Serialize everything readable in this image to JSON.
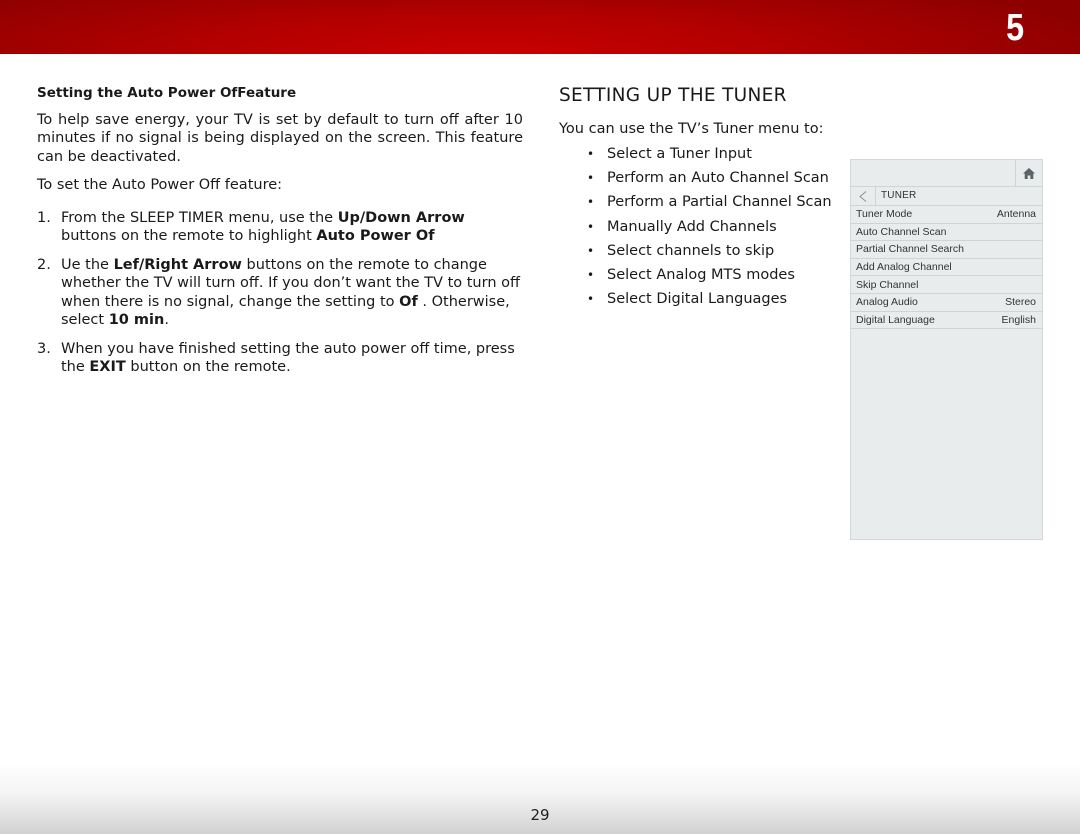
{
  "header": {
    "chapter_number": "5",
    "accent_color": "#b80000"
  },
  "left": {
    "subtitle": "Setting the Auto Power OfFeature",
    "intro": "To help save energy, your TV is set by default to turn off after 10 minutes if no signal is being displayed on the screen. This feature can be deactivated.",
    "lead": "To set the Auto Power Off feature:",
    "steps": [
      {
        "num": "1.",
        "t1": "From the SLEEP TIMER menu, use the ",
        "b1": "Up/Down Arrow",
        "t2": " buttons on the remote to highlight ",
        "b2": "Auto Power Of",
        "t3": ""
      },
      {
        "num": "2.",
        "t1": "Ue the ",
        "b1": "Lef/Right Arrow",
        "t2": "  buttons on the remote to change whether the TV will turn off. If you don’t want the TV to turn off when there is no signal, change the setting to ",
        "b2": "Of",
        "t3": " . Otherwise, select ",
        "b3": "10 min",
        "t4": "."
      },
      {
        "num": "3.",
        "t1": "When you have finished setting the auto power off time, press the ",
        "b1": "EXIT",
        "t2": " button on the remote."
      }
    ]
  },
  "middle": {
    "title": "SETTING UP THE TUNER",
    "intro": "You can use the TV’s Tuner menu to:",
    "bullets": [
      "Select a Tuner Input",
      "Perform an Auto Channel Scan",
      "Perform a Partial Channel Scan",
      "Manually Add Channels",
      "Select channels to skip",
      "Select Analog MTS modes",
      "Select Digital Languages"
    ]
  },
  "tv_menu": {
    "title": "TUNER",
    "home_icon": "home-icon",
    "back_icon": "back-triangle-icon",
    "rows": [
      {
        "label": "Tuner Mode",
        "value": "Antenna"
      },
      {
        "label": "Auto Channel Scan",
        "value": ""
      },
      {
        "label": "Partial Channel Search",
        "value": ""
      },
      {
        "label": "Add Analog Channel",
        "value": ""
      },
      {
        "label": "Skip Channel",
        "value": ""
      },
      {
        "label": "Analog Audio",
        "value": "Stereo"
      },
      {
        "label": "Digital Language",
        "value": "English"
      }
    ]
  },
  "footer": {
    "page_number": "29"
  }
}
